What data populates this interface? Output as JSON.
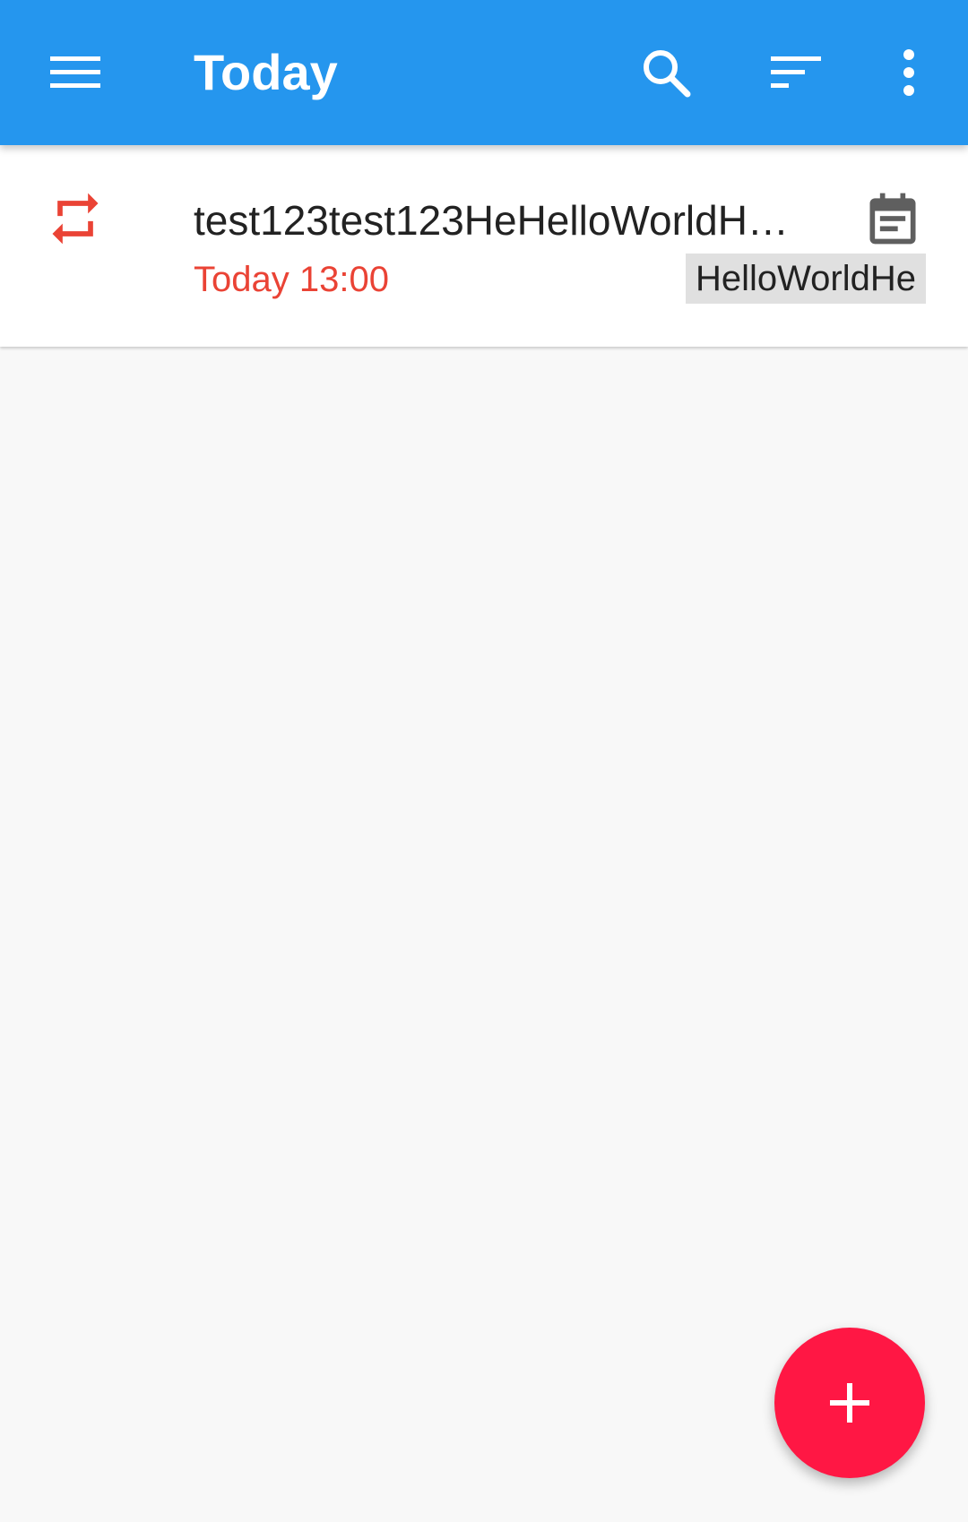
{
  "appbar": {
    "title": "Today",
    "icons": {
      "menu": "menu-icon",
      "search": "search-icon",
      "sort": "sort-icon",
      "more": "more-vert-icon"
    },
    "color": "#2596ee"
  },
  "tasks": [
    {
      "title": "test123test123HeHelloWorldH…",
      "time": "Today 13:00",
      "tag": "HelloWorldHe",
      "leading_icon": "repeat-icon",
      "trailing_icon": "calendar-note-icon",
      "time_color": "#ea4335"
    }
  ],
  "fab": {
    "icon": "plus-icon",
    "color": "#ff1744"
  }
}
